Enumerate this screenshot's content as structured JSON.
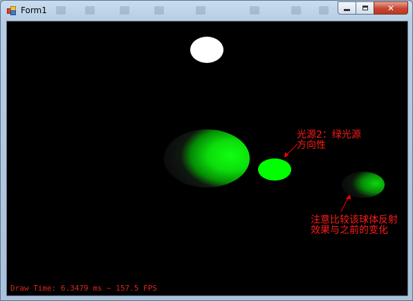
{
  "window": {
    "title": "Form1",
    "controls": {
      "minimize": "minimize-icon",
      "maximize": "maximize-icon",
      "close": "close-icon"
    },
    "close_glyph": "✕"
  },
  "scene": {
    "background_color": "#000000",
    "annotations": {
      "light2": [
        "光源2：绿光源",
        "方向性"
      ],
      "sphere_note": [
        "注意比较该球体反射",
        "效果与之前的变化"
      ]
    },
    "annotation_color": "#ff0000",
    "sphere_colors": {
      "white": "#ffffff",
      "green": "#00ff00"
    }
  },
  "status": {
    "draw_time": "Draw Time: 6.3479 ms ~ 157.5 FPS"
  }
}
